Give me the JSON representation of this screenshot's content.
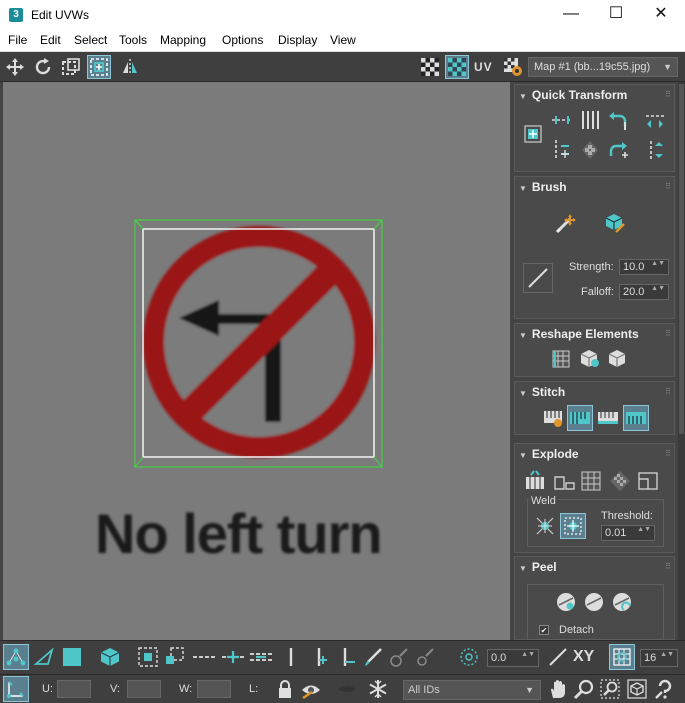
{
  "window": {
    "title": "Edit UVWs",
    "app_icon_glyph": "3",
    "minimize_glyph": "—",
    "maximize_glyph": "☐",
    "close_glyph": "✕"
  },
  "menu": {
    "items": [
      "File",
      "Edit",
      "Select",
      "Tools",
      "Mapping",
      "Options",
      "Display",
      "View"
    ]
  },
  "toolbar": {
    "uv_label": "UV",
    "map_dropdown": "Map #1 (bb...19c55.jpg)",
    "dropdown_arrow": "▼"
  },
  "viewport": {
    "sign_caption": "No left turn"
  },
  "panel": {
    "quick_transform": {
      "title": "Quick Transform"
    },
    "brush": {
      "title": "Brush",
      "strength_label": "Strength:",
      "strength_value": "10.0",
      "falloff_label": "Falloff:",
      "falloff_value": "20.0"
    },
    "reshape": {
      "title": "Reshape Elements"
    },
    "stitch": {
      "title": "Stitch"
    },
    "explode": {
      "title": "Explode",
      "weld_label": "Weld",
      "threshold_label": "Threshold:",
      "threshold_value": "0.01"
    },
    "peel": {
      "title": "Peel",
      "detach_label": "Detach",
      "detach_checked": true,
      "check_glyph": "✔"
    },
    "collapse_glyph": "▼",
    "grip_glyph": "⠿",
    "spin_glyph": "▲▼"
  },
  "bottom": {
    "angle_value": "0.0",
    "xy_label": "XY",
    "pixel_value": "16",
    "u_label": "U:",
    "v_label": "V:",
    "w_label": "W:",
    "l_label": "L:",
    "ids_dropdown": "All IDs",
    "ids_arrow": "▼"
  },
  "colors": {
    "accent": "#4fc7c9",
    "selected_bg": "#5a7f8e",
    "selection_box": "#38e038",
    "sign_red": "#9a1414"
  }
}
